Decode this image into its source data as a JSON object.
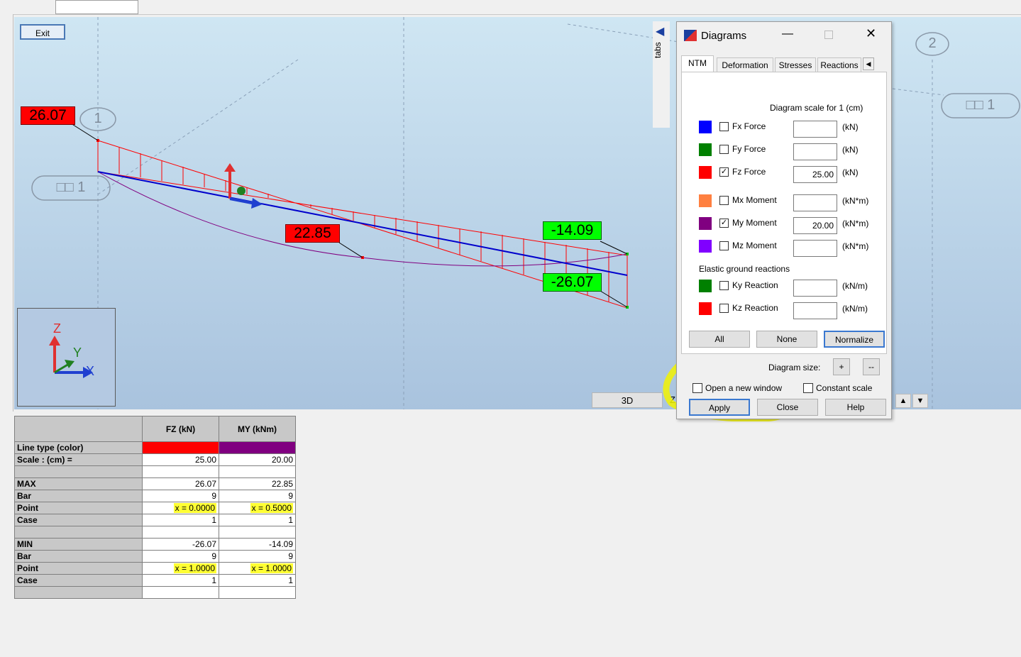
{
  "viewport": {
    "exit_label": "Exit",
    "tabs_label": "tabs",
    "bottom_tab": "3D",
    "bottom_tab_z": "Z",
    "node_labels": [
      "1",
      "2"
    ],
    "structure_labels": [
      "□□ 1",
      "□□ 1"
    ],
    "value_labels": {
      "max_fz": "26.07",
      "max_my": "22.85",
      "min_my": "-14.09",
      "min_fz": "-26.07"
    },
    "axis_labels": {
      "z": "Z",
      "y": "Y",
      "x": "X"
    }
  },
  "dialog": {
    "title": "Diagrams",
    "tabs": [
      "NTM",
      "Deformation",
      "Stresses",
      "Reactions"
    ],
    "scale_caption": "Diagram scale for 1  (cm)",
    "rows": [
      {
        "color": "#0000ff",
        "label": "Fx Force",
        "checked": false,
        "value": "",
        "unit": "(kN)"
      },
      {
        "color": "#008000",
        "label": "Fy Force",
        "checked": false,
        "value": "",
        "unit": "(kN)"
      },
      {
        "color": "#ff0000",
        "label": "Fz Force",
        "checked": true,
        "value": "25.00",
        "unit": "(kN)"
      },
      {
        "color": "#ff8040",
        "label": "Mx Moment",
        "checked": false,
        "value": "",
        "unit": "(kN*m)"
      },
      {
        "color": "#800080",
        "label": "My Moment",
        "checked": true,
        "value": "20.00",
        "unit": "(kN*m)"
      },
      {
        "color": "#8000ff",
        "label": "Mz Moment",
        "checked": false,
        "value": "",
        "unit": "(kN*m)"
      }
    ],
    "elastic_caption": "Elastic ground reactions",
    "elastic_rows": [
      {
        "color": "#008000",
        "label": "Ky Reaction",
        "checked": false,
        "value": "",
        "unit": "(kN/m)"
      },
      {
        "color": "#ff0000",
        "label": "Kz Reaction",
        "checked": false,
        "value": "",
        "unit": "(kN/m)"
      }
    ],
    "btn_all": "All",
    "btn_none": "None",
    "btn_normalize": "Normalize",
    "diagram_size_label": "Diagram size:",
    "btn_plus": "+",
    "btn_minus": "--",
    "open_new_window": "Open a new window",
    "constant_scale": "Constant scale",
    "btn_apply": "Apply",
    "btn_close": "Close",
    "btn_help": "Help"
  },
  "table": {
    "headers": [
      "FZ (kN)",
      "MY (kNm)"
    ],
    "line_type_label": "Line type (color)",
    "line_colors": [
      "#ff0000",
      "#800080"
    ],
    "scale_label": "Scale : (cm) =",
    "scale_values": [
      "25.00",
      "20.00"
    ],
    "max": {
      "label": "MAX",
      "values": [
        "26.07",
        "22.85"
      ],
      "bar_label": "Bar",
      "bars": [
        "9",
        "9"
      ],
      "point_label": "Point",
      "points": [
        "x = 0.0000",
        "x = 0.5000"
      ],
      "case_label": "Case",
      "cases": [
        "1",
        "1"
      ]
    },
    "min": {
      "label": "MIN",
      "values": [
        "-26.07",
        "-14.09"
      ],
      "bar_label": "Bar",
      "bars": [
        "9",
        "9"
      ],
      "point_label": "Point",
      "points": [
        "x = 1.0000",
        "x = 1.0000"
      ],
      "case_label": "Case",
      "cases": [
        "1",
        "1"
      ]
    }
  },
  "colors": {
    "highlight": "#ffff33",
    "fz_diagram": "#ff0000",
    "my_diagram": "#800080",
    "bar": "#0000cc"
  }
}
